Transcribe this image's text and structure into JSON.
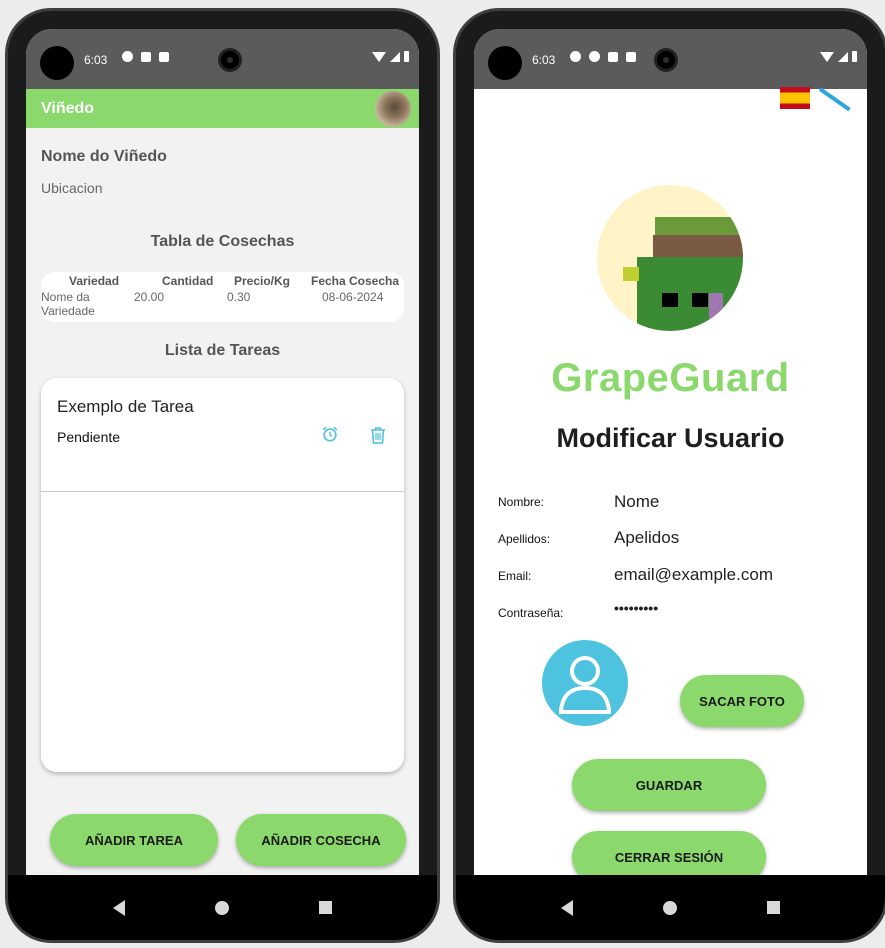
{
  "status": {
    "time": "6:03"
  },
  "left": {
    "appbar_title": "Viñedo",
    "vineyard_name": "Nome do Viñedo",
    "vineyard_location": "Ubicacion",
    "harvest_title": "Tabla de Cosechas",
    "harvest_table": {
      "headers": [
        "Variedad",
        "Cantidad",
        "Precio/Kg",
        "Fecha Cosecha"
      ],
      "rows": [
        [
          "Nome da Variedade",
          "20.00",
          "0.30",
          "08-06-2024"
        ]
      ]
    },
    "tasks_title": "Lista de Tareas",
    "tasks": [
      {
        "title": "Exemplo de Tarea",
        "status": "Pendiente"
      }
    ],
    "buttons": {
      "add_task": "AÑADIR TAREA",
      "add_harvest": "AÑADIR COSECHA"
    }
  },
  "right": {
    "brand": "GrapeGuard",
    "title": "Modificar Usuario",
    "fields": [
      {
        "label": "Nombre:",
        "value": "Nome"
      },
      {
        "label": "Apellidos:",
        "value": "Apelidos"
      },
      {
        "label": "Email:",
        "value": "email@example.com"
      },
      {
        "label": "Contraseña:",
        "value": "•••••••••"
      }
    ],
    "buttons": {
      "take_photo": "SACAR FOTO",
      "save": "GUARDAR",
      "logout": "CERRAR SESIÓN"
    }
  },
  "colors": {
    "accent": "#8bd96d",
    "icon": "#4dc3e0",
    "appbar_text": "#ffffff"
  }
}
